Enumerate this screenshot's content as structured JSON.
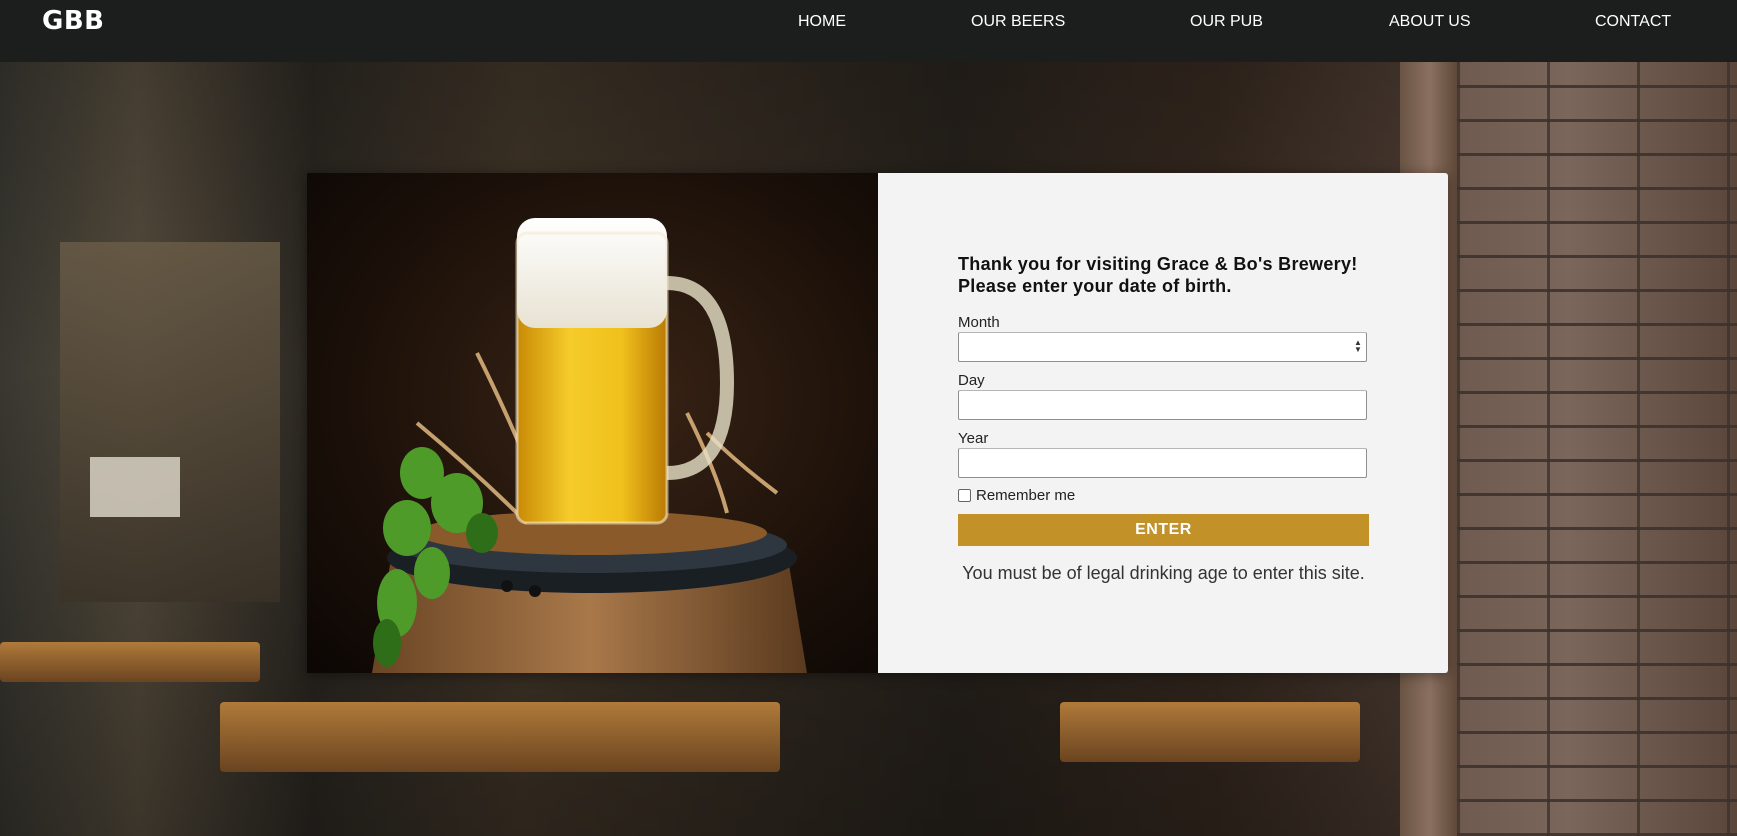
{
  "header": {
    "logo": "GBB",
    "nav": [
      "HOME",
      "OUR BEERS",
      "OUR PUB",
      "ABOUT US",
      "CONTACT"
    ]
  },
  "age_gate": {
    "heading": "Thank you for visiting Grace & Bo's Brewery! Please enter your date of birth.",
    "month_label": "Month",
    "month_value": "",
    "day_label": "Day",
    "day_value": "",
    "year_label": "Year",
    "year_value": "",
    "remember_label": "Remember me",
    "remember_checked": false,
    "enter_label": "ENTER",
    "legal_note": "You must be of legal drinking age to enter this site."
  },
  "colors": {
    "header_bg": "#1c1e1d",
    "button_bg": "#c29127",
    "form_bg": "#f3f3f3"
  },
  "icons": {
    "month_spinner": "spinner-icon",
    "beer_image": "beer-mug-on-barrel-image"
  }
}
